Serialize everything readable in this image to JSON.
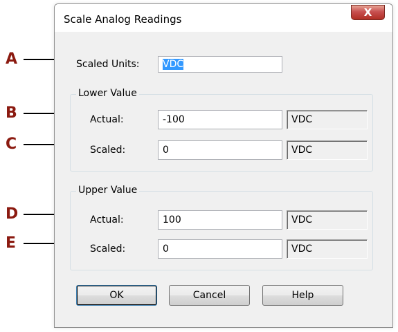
{
  "dialog": {
    "title": "Scale Analog Readings",
    "close_glyph": "X"
  },
  "scaled_units": {
    "label": "Scaled Units:",
    "value": "VDC"
  },
  "lower_group": {
    "legend": "Lower Value",
    "actual_label": "Actual:",
    "actual_value": "-100",
    "actual_unit": "VDC",
    "scaled_label": "Scaled:",
    "scaled_value": "0",
    "scaled_unit": "VDC"
  },
  "upper_group": {
    "legend": "Upper Value",
    "actual_label": "Actual:",
    "actual_value": "100",
    "actual_unit": "VDC",
    "scaled_label": "Scaled:",
    "scaled_value": "0",
    "scaled_unit": "VDC"
  },
  "buttons": {
    "ok": "OK",
    "cancel": "Cancel",
    "help": "Help"
  },
  "callouts": [
    "A",
    "B",
    "C",
    "D",
    "E"
  ],
  "colors": {
    "callout_letter": "#8b1a10",
    "close_button": "#c75050",
    "selection": "#3399ff"
  }
}
